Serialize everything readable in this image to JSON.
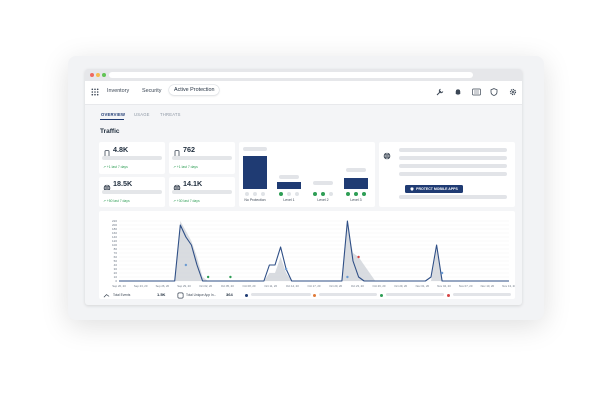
{
  "nav": {
    "tabs": [
      "Inventory",
      "Security",
      "Active Protection"
    ],
    "active_tab": "Active Protection",
    "icons": [
      "grid-icon",
      "wrench-icon",
      "bell-icon",
      "list-icon",
      "shield-icon",
      "gear-icon"
    ]
  },
  "subtabs": {
    "items": [
      "OVERVIEW",
      "USAGE",
      "THREATS"
    ],
    "active": "OVERVIEW"
  },
  "section_title": "Traffic",
  "stats": [
    {
      "value": "4.8K",
      "trend": "+1 last 7 days",
      "icon": "phone-icon"
    },
    {
      "value": "762",
      "trend": "+1 last 7 days",
      "icon": "phone-icon"
    },
    {
      "value": "18.5K",
      "trend": "+50 last 7 days",
      "icon": "globe-icon"
    },
    {
      "value": "14.1K",
      "trend": "+30 last 7 days",
      "icon": "globe-icon"
    }
  ],
  "levels": {
    "labels": [
      "No Protection",
      "Level 1",
      "Level 2",
      "Level 3"
    ],
    "fill": [
      1.0,
      0.22,
      0.0,
      0.34
    ]
  },
  "protect": {
    "button_label": "PROTECT MOBILE APPS"
  },
  "chart_data": {
    "type": "area",
    "title": "",
    "xlabel": "",
    "ylabel": "",
    "ylim": [
      0,
      220
    ],
    "y_ticks": [
      0,
      10,
      20,
      30,
      40,
      50,
      60,
      70,
      80,
      100,
      120,
      140,
      160,
      180,
      200,
      220
    ],
    "x_tick_labels": [
      "Sep 20, 20",
      "Sep 23, 20",
      "Sep 26, 20",
      "Sep 29, 20",
      "Oct 02, 20",
      "Oct 05, 20",
      "Oct 08, 20",
      "Oct 11, 20",
      "Oct 14, 20",
      "Oct 17, 20",
      "Oct 20, 20",
      "Oct 23, 20",
      "Oct 26, 20",
      "Oct 29, 20",
      "Nov 01, 20",
      "Nov 04, 20",
      "Nov 07, 20",
      "Nov 10, 20",
      "Nov 13, 20"
    ],
    "series": [
      {
        "name": "",
        "values": [
          0,
          0,
          0,
          0,
          0,
          0,
          0,
          0,
          0,
          0,
          0,
          200,
          140,
          100,
          40,
          0,
          0,
          0,
          0,
          0,
          0,
          0,
          0,
          0,
          0,
          0,
          0,
          40,
          40,
          90,
          30,
          0,
          0,
          0,
          0,
          0,
          0,
          0,
          0,
          0,
          0,
          230,
          50,
          10,
          0,
          0,
          0,
          0,
          0,
          0,
          0,
          0,
          0,
          0,
          0,
          0,
          10,
          100,
          0,
          0,
          0,
          0,
          0,
          0,
          0,
          0,
          0,
          0,
          0,
          0,
          0
        ]
      },
      {
        "name": "",
        "values": [
          0,
          0,
          0,
          0,
          0,
          0,
          0,
          0,
          0,
          0,
          0,
          220,
          170,
          120,
          60,
          10,
          0,
          0,
          0,
          0,
          0,
          0,
          0,
          0,
          0,
          0,
          0,
          20,
          20,
          60,
          20,
          0,
          0,
          0,
          0,
          0,
          0,
          0,
          0,
          0,
          0,
          200,
          70,
          60,
          40,
          20,
          0,
          0,
          0,
          0,
          0,
          0,
          0,
          0,
          0,
          0,
          0,
          80,
          0,
          0,
          0,
          0,
          0,
          0,
          0,
          0,
          0,
          0,
          0,
          0,
          0
        ]
      }
    ]
  },
  "legend": {
    "items": [
      {
        "label": "Total Events",
        "value": "1.5K"
      },
      {
        "label": "Total Unique App In...",
        "value": "364"
      }
    ]
  }
}
